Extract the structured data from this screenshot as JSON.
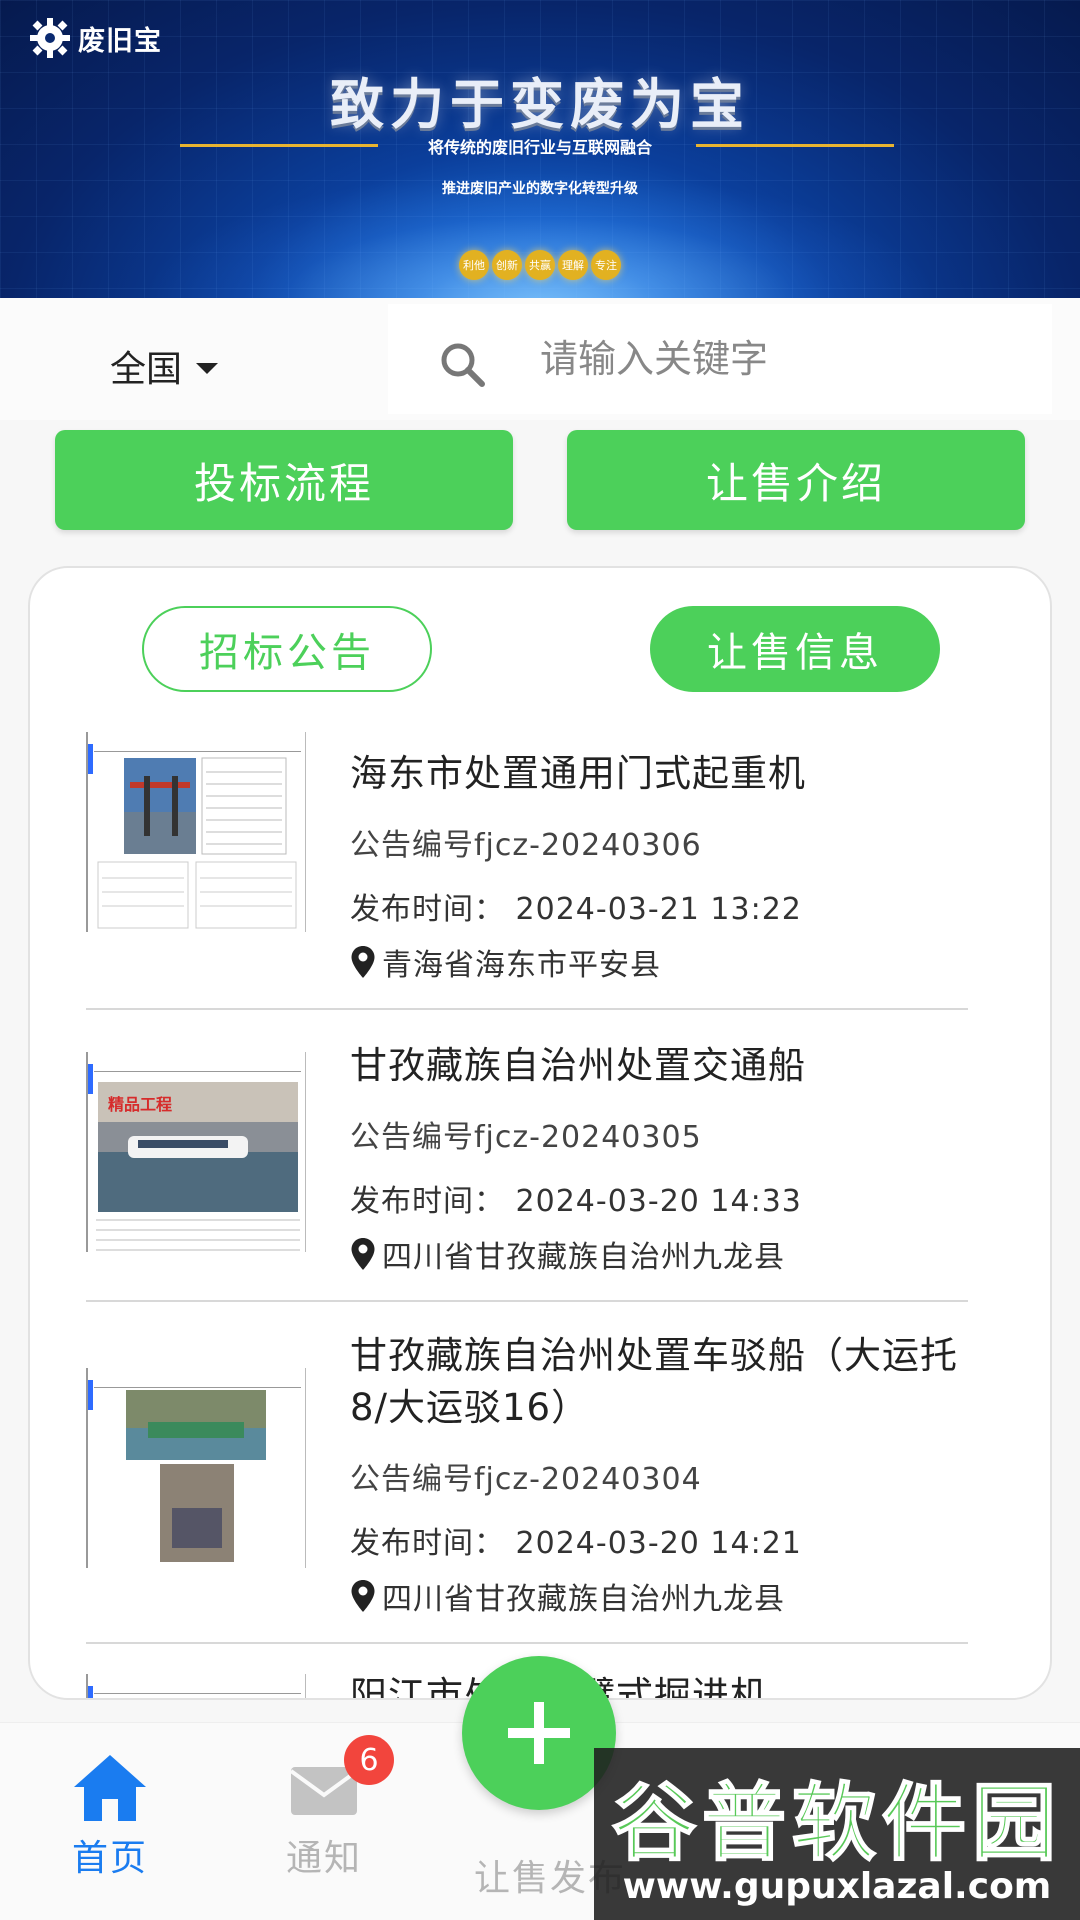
{
  "banner": {
    "logo_text": "废旧宝",
    "title": "致力于变废为宝",
    "subtitle": "将传统的废旧行业与互联网融合",
    "subtitle2": "推进废旧产业的数字化转型升级",
    "tags": [
      "利他",
      "创新",
      "共赢",
      "理解",
      "专注"
    ]
  },
  "filter": {
    "region": "全国",
    "search_placeholder": "请输入关键字"
  },
  "actions": {
    "bid_process": "投标流程",
    "sale_intro": "让售介绍"
  },
  "segments": {
    "tender": "招标公告",
    "sale": "让售信息",
    "active": "sale"
  },
  "listings": [
    {
      "title": "海东市处置通用门式起重机",
      "number": "公告编号fjcz-20240306",
      "time": "发布时间：  2024-03-21 13:22",
      "location": "青海省海东市平安县"
    },
    {
      "title": "甘孜藏族自治州处置交通船",
      "number": "公告编号fjcz-20240305",
      "time": "发布时间：  2024-03-20 14:33",
      "location": "四川省甘孜藏族自治州九龙县"
    },
    {
      "title": "甘孜藏族自治州处置车驳船（大运托8/大运驳16）",
      "number": "公告编号fjcz-20240304",
      "time": "发布时间：  2024-03-20 14:21",
      "location": "四川省甘孜藏族自治州九龙县"
    },
    {
      "title": "阳江市处置悬臂式掘进机",
      "number": "",
      "time": "",
      "location": ""
    }
  ],
  "nav": {
    "home": "首页",
    "notice": "通知",
    "notice_badge": "6",
    "sell_publish": "让售发布"
  },
  "watermark": {
    "name": "谷普软件园",
    "url": "www.gupuxlazal.com"
  },
  "colors": {
    "primary_green": "#4cd05a",
    "nav_active_blue": "#1a7cf0",
    "badge_red": "#f2453d"
  }
}
